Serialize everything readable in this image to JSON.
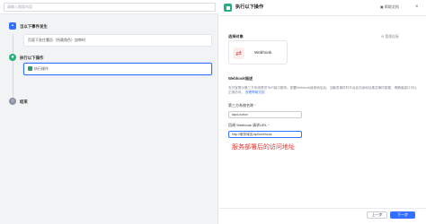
{
  "search": {
    "placeholder": "请输入搜索内容"
  },
  "flow": {
    "trigger": {
      "title": "当以下事件发生",
      "detail": "页面下发住署员（所属角色）加审时"
    },
    "action": {
      "title": "执行以下操作",
      "item_label": "执行操作"
    },
    "end": {
      "title": "结束"
    }
  },
  "panel": {
    "title": "执行以下操作",
    "help_label": "帮助文档",
    "close_glyph": "×",
    "connector_section_label": "选择对象",
    "manage_link": "管理连接",
    "connector": {
      "name": "Webhook",
      "icon": "webhook-icon"
    },
    "webhook_section_label": "Webhook描述",
    "description": "支付宝提示第三方系统提供TAPI接口服务。配置Webhook接收地址后，当触发事件时平台会向该地址推送事件数据，请确保接口可以正常访问。",
    "description_link": "查看帮助文档",
    "system_name": {
      "label": "第三方系统名称",
      "value": "tapd-notice"
    },
    "webhook_url": {
      "label": "回调 Webhook 请求URL",
      "value": "http://服务域名/api/webhook"
    },
    "annotation": "服务部署后的访问地址"
  },
  "footer": {
    "prev_label": "上一步",
    "next_label": "下一步"
  },
  "colors": {
    "primary": "#3370ff",
    "accent_green": "#26b07a",
    "annotation_red": "#e0342b"
  }
}
